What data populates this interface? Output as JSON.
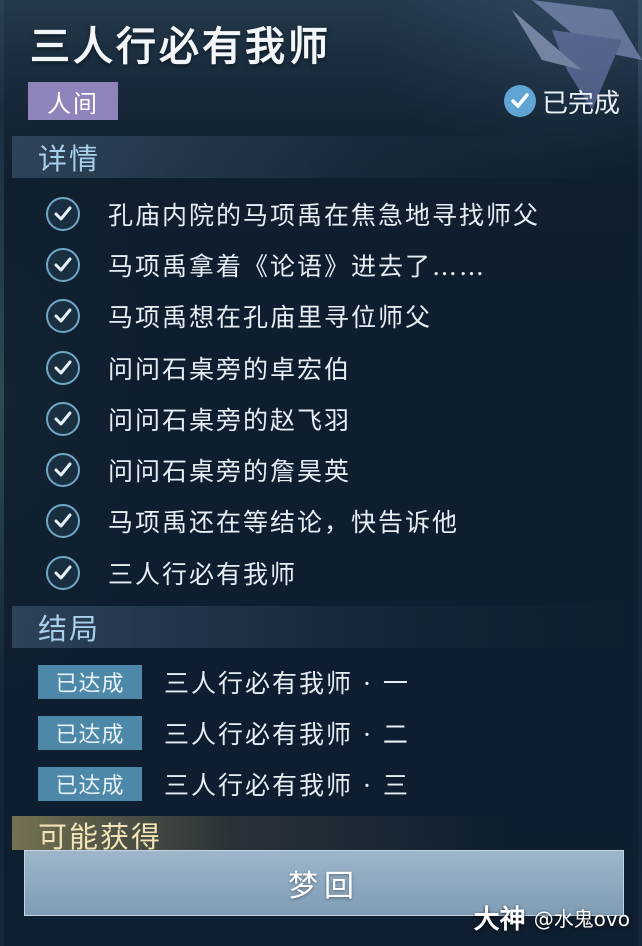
{
  "header": {
    "title": "三人行必有我师",
    "category_tag": "人间",
    "status": "已完成"
  },
  "details": {
    "heading": "详情",
    "items": [
      "孔庙内院的马项禹在焦急地寻找师父",
      "马项禹拿着《论语》进去了……",
      "马项禹想在孔庙里寻位师父",
      "问问石桌旁的卓宏伯",
      "问问石桌旁的赵飞羽",
      "问问石桌旁的詹昊英",
      "马项禹还在等结论，快告诉他",
      "三人行必有我师"
    ]
  },
  "endings": {
    "heading": "结局",
    "items": [
      {
        "badge": "已达成",
        "label": "三人行必有我师 · 一"
      },
      {
        "badge": "已达成",
        "label": "三人行必有我师 · 二"
      },
      {
        "badge": "已达成",
        "label": "三人行必有我师 · 三"
      }
    ]
  },
  "rewards": {
    "heading": "可能获得"
  },
  "action": {
    "button_label": "梦回"
  },
  "watermark": {
    "logo": "大神",
    "user": "@水鬼ovo"
  },
  "colors": {
    "accent": "#5fa4d2",
    "tag_bg": "#8f83bc",
    "badge_bg": "#4d88a8",
    "section_heading": "#a9d0ea"
  }
}
